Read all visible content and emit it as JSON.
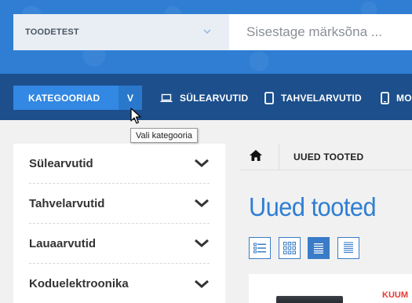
{
  "search": {
    "category_label": "TOODETEST",
    "placeholder": "Sisestage märksõna ..."
  },
  "nav": {
    "categories_button": "KATEGOORIAD",
    "toggle_label": "V",
    "items": [
      {
        "label": "SÜLEARVUTID",
        "icon": "laptop-icon"
      },
      {
        "label": "TAHVELARVUTID",
        "icon": "tablet-icon"
      },
      {
        "label": "MO",
        "icon": "phone-icon"
      }
    ]
  },
  "tooltip": "Vali kategooria",
  "sidebar": {
    "items": [
      {
        "label": "Sülearvutid"
      },
      {
        "label": "Tahvelarvutid"
      },
      {
        "label": "Lauaarvutid"
      },
      {
        "label": "Koduelektroonika"
      }
    ]
  },
  "breadcrumb": {
    "current": "UUED TOOTED"
  },
  "main": {
    "title": "Uued tooted",
    "badge": "KUUM"
  },
  "colors": {
    "brand_blue": "#2f7ed4",
    "nav_dark": "#1c4f8c",
    "accent_red": "#e53935"
  }
}
